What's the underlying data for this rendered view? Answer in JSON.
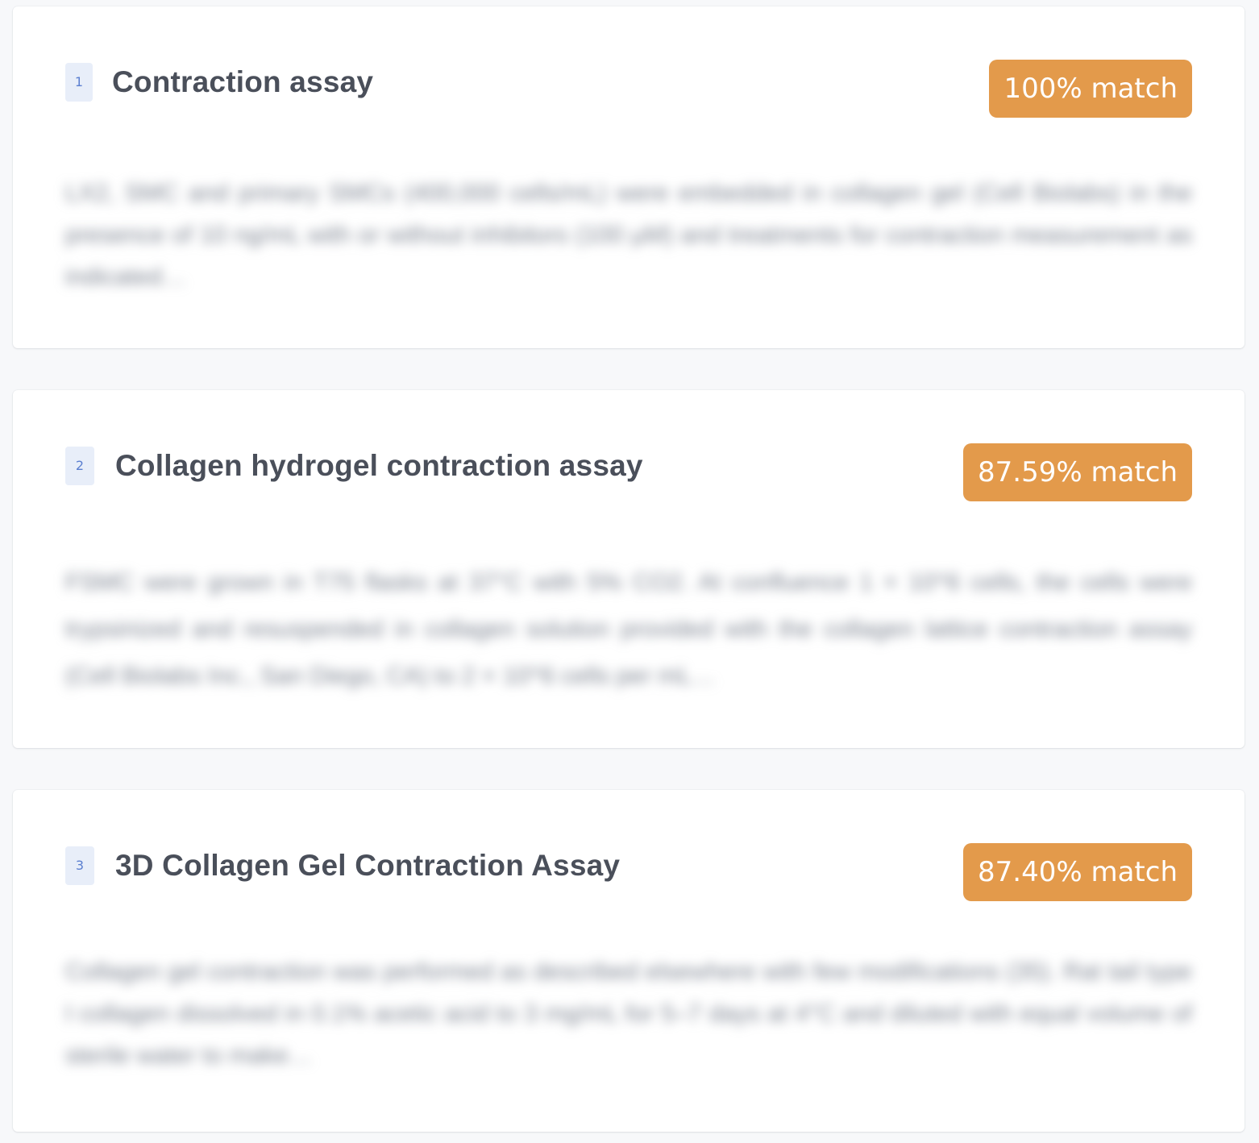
{
  "results": [
    {
      "rank": "1",
      "title": "Contraction assay",
      "match": "100% match",
      "snippet": "LX2, SMC and primary SMCs (400,000 cells/mL) were embedded in collagen gel (Cell Biolabs) in the presence of 10 ng/mL with or without inhibitors (100 µM) and treatments for contraction measurement as indicated…"
    },
    {
      "rank": "2",
      "title": "Collagen hydrogel contraction assay",
      "match": "87.59% match",
      "snippet": "FSMC were grown in T75 flasks at 37°C with 5% CO2. At confluence 1 × 10^6 cells, the cells were trypsinized and resuspended in collagen solution provided with the collagen lattice contraction assay (Cell Biolabs Inc., San Diego, CA) to 2 × 10^6 cells per mL…"
    },
    {
      "rank": "3",
      "title": "3D Collagen Gel Contraction Assay",
      "match": "87.40% match",
      "snippet": "Collagen gel contraction was performed as described elsewhere with few modifications (35). Rat tail type I collagen dissolved in 0.1% acetic acid to 3 mg/mL for 5–7 days at 4°C and diluted with equal volume of sterile water to make…"
    }
  ],
  "colors": {
    "match_badge_bg": "#e39a4b",
    "rank_badge_bg": "#e8eef9",
    "rank_text": "#5b7fd0",
    "title_text": "#4a4f5a"
  }
}
